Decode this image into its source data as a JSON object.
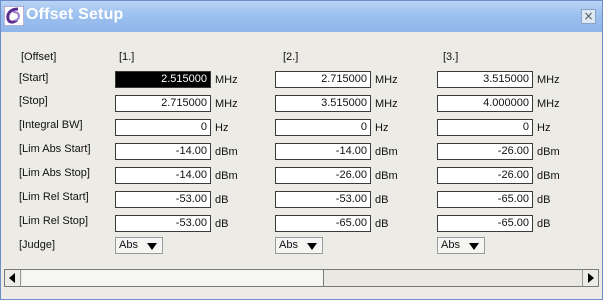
{
  "window": {
    "title": "Offset Setup",
    "close_label": "×"
  },
  "row_labels": {
    "offset": "[Offset]",
    "start": "[Start]",
    "stop": "[Stop]",
    "integral_bw": "[Integral BW]",
    "lim_abs_start": "[Lim Abs Start]",
    "lim_abs_stop": "[Lim Abs Stop]",
    "lim_rel_start": "[Lim Rel Start]",
    "lim_rel_stop": "[Lim Rel Stop]",
    "judge": "[Judge]"
  },
  "units": {
    "mhz": "MHz",
    "hz": "Hz",
    "dbm": "dBm",
    "db": "dB"
  },
  "columns": [
    {
      "header": "[1.]",
      "start": "2.515000",
      "stop": "2.715000",
      "integral_bw": "0",
      "lim_abs_start": "-14.00",
      "lim_abs_stop": "-14.00",
      "lim_rel_start": "-53.00",
      "lim_rel_stop": "-53.00",
      "judge": "Abs"
    },
    {
      "header": "[2.]",
      "start": "2.715000",
      "stop": "3.515000",
      "integral_bw": "0",
      "lim_abs_start": "-14.00",
      "lim_abs_stop": "-26.00",
      "lim_rel_start": "-53.00",
      "lim_rel_stop": "-65.00",
      "judge": "Abs"
    },
    {
      "header": "[3.]",
      "start": "3.515000",
      "stop": "4.000000",
      "integral_bw": "0",
      "lim_abs_start": "-26.00",
      "lim_abs_stop": "-26.00",
      "lim_rel_start": "-65.00",
      "lim_rel_stop": "-65.00",
      "judge": "Abs"
    }
  ],
  "scrollbar": {
    "position": 0,
    "visible_fraction": 0.52
  }
}
